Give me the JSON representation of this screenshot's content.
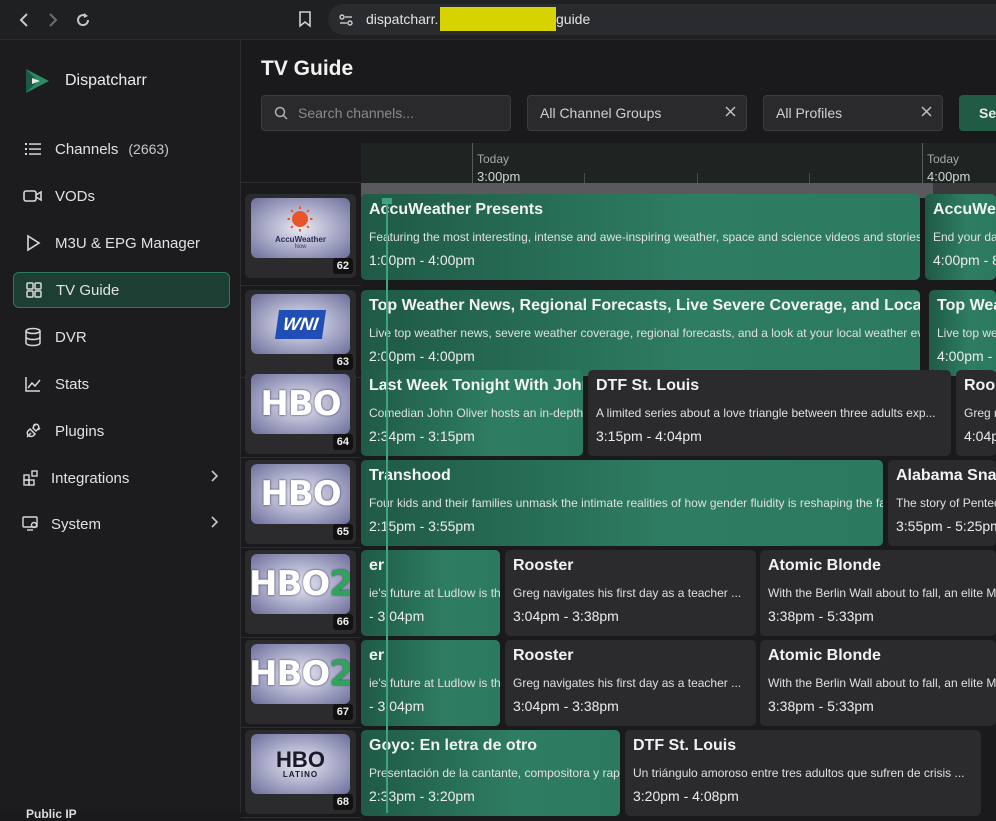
{
  "browser": {
    "url_prefix": "dispatcharr.",
    "url_suffix": "guide"
  },
  "sidebar": {
    "brand": "Dispatcharr",
    "items": [
      {
        "label": "Channels",
        "count": "(2663)",
        "icon": "list-icon"
      },
      {
        "label": "VODs",
        "icon": "video-camera-icon"
      },
      {
        "label": "M3U & EPG Manager",
        "icon": "play-icon"
      },
      {
        "label": "TV Guide",
        "icon": "grid-icon",
        "active": true
      },
      {
        "label": "DVR",
        "icon": "database-icon"
      },
      {
        "label": "Stats",
        "icon": "chart-line-icon"
      },
      {
        "label": "Plugins",
        "icon": "plug-icon"
      },
      {
        "label": "Integrations",
        "icon": "integrations-icon"
      },
      {
        "label": "System",
        "icon": "system-icon"
      }
    ],
    "bottom_label": "Public IP"
  },
  "main": {
    "title": "TV Guide",
    "search_placeholder": "Search channels...",
    "group_filter": "All Channel Groups",
    "profile_filter": "All Profiles",
    "search_button": "Se"
  },
  "timeline": [
    {
      "day": "Today",
      "time": "3:00pm"
    },
    {
      "day": "Today",
      "time": "4:00pm"
    }
  ],
  "rows": [
    {
      "number": "62",
      "logo": "accuweather",
      "programs": [
        {
          "title": "AccuWeather Presents",
          "desc": "Featuring the most interesting, intense and awe-inspiring weather, space and science videos and stories",
          "time": "1:00pm - 4:00pm",
          "style": "green"
        },
        {
          "title": "AccuWe",
          "desc": "End your da",
          "time": "4:00pm - 8",
          "style": "green"
        }
      ]
    },
    {
      "number": "63",
      "logo": "wni",
      "programs": [
        {
          "title": "Top Weather News, Regional Forecasts, Live Severe Coverage, and Loca",
          "desc": "Live top weather news, severe weather coverage, regional forecasts, and a look at your local weather ev",
          "time": "2:00pm - 4:00pm",
          "style": "green"
        },
        {
          "title": "Top Wea",
          "desc": "Live top wea",
          "time": "4:00pm - 6",
          "style": "green"
        }
      ]
    },
    {
      "number": "64",
      "logo": "hbo",
      "programs": [
        {
          "title": "Last Week Tonight With John",
          "desc": "Comedian John Oliver hosts an in-depth...",
          "time": "2:34pm - 3:15pm",
          "style": "green"
        },
        {
          "title": "DTF St. Louis",
          "desc": "A limited series about a love triangle between three adults exp...",
          "time": "3:15pm - 4:04pm",
          "style": "grey"
        },
        {
          "title": "Roos",
          "desc": "Greg n",
          "time": "4:04p",
          "style": "grey"
        }
      ]
    },
    {
      "number": "65",
      "logo": "hbo",
      "programs": [
        {
          "title": "Transhood",
          "desc": "Four kids and their families unmask the intimate realities of how gender fluidity is reshaping the fa",
          "time": "2:15pm - 3:55pm",
          "style": "green"
        },
        {
          "title": "Alabama Sna",
          "desc": "The story of Pented",
          "time": "3:55pm - 5:25pm",
          "style": "grey"
        }
      ]
    },
    {
      "number": "66",
      "logo": "hbo2",
      "programs": [
        {
          "title": "er",
          "desc": "ie's future at Ludlow is thr...",
          "time": "- 3:04pm",
          "style": "green"
        },
        {
          "title": "Rooster",
          "desc": "Greg navigates his first day as a teacher ...",
          "time": "3:04pm - 3:38pm",
          "style": "grey"
        },
        {
          "title": "Atomic Blonde",
          "desc": "With the Berlin Wall about to fall, an elite M",
          "time": "3:38pm - 5:33pm",
          "style": "grey"
        }
      ]
    },
    {
      "number": "67",
      "logo": "hbo2",
      "programs": [
        {
          "title": "er",
          "desc": "ie's future at Ludlow is thr...",
          "time": "- 3:04pm",
          "style": "green"
        },
        {
          "title": "Rooster",
          "desc": "Greg navigates his first day as a teacher ...",
          "time": "3:04pm - 3:38pm",
          "style": "grey"
        },
        {
          "title": "Atomic Blonde",
          "desc": "With the Berlin Wall about to fall, an elite M",
          "time": "3:38pm - 5:33pm",
          "style": "grey"
        }
      ]
    },
    {
      "number": "68",
      "logo": "hbo-latino",
      "programs": [
        {
          "title": "Goyo: En letra de otro",
          "desc": "Presentación de la cantante, compositora y rape",
          "time": "2:33pm - 3:20pm",
          "style": "green"
        },
        {
          "title": "DTF St. Louis",
          "desc": "Un triángulo amoroso entre tres adultos que sufren de crisis ...",
          "time": "3:20pm - 4:08pm",
          "style": "grey"
        }
      ]
    }
  ],
  "logo_text": {
    "accuweather": "AccuWeather",
    "accuweather_sub": "Now",
    "wni": "WNI",
    "hbo": "HBO",
    "hbo2_a": "HBO",
    "hbo2_b": "2",
    "hbo_latino_a": "HBO",
    "hbo_latino_b": "LATINO"
  },
  "colors": {
    "accent": "#2f7a5e",
    "program_active": "#2e7d63",
    "program_inactive": "#2b2b2e"
  }
}
